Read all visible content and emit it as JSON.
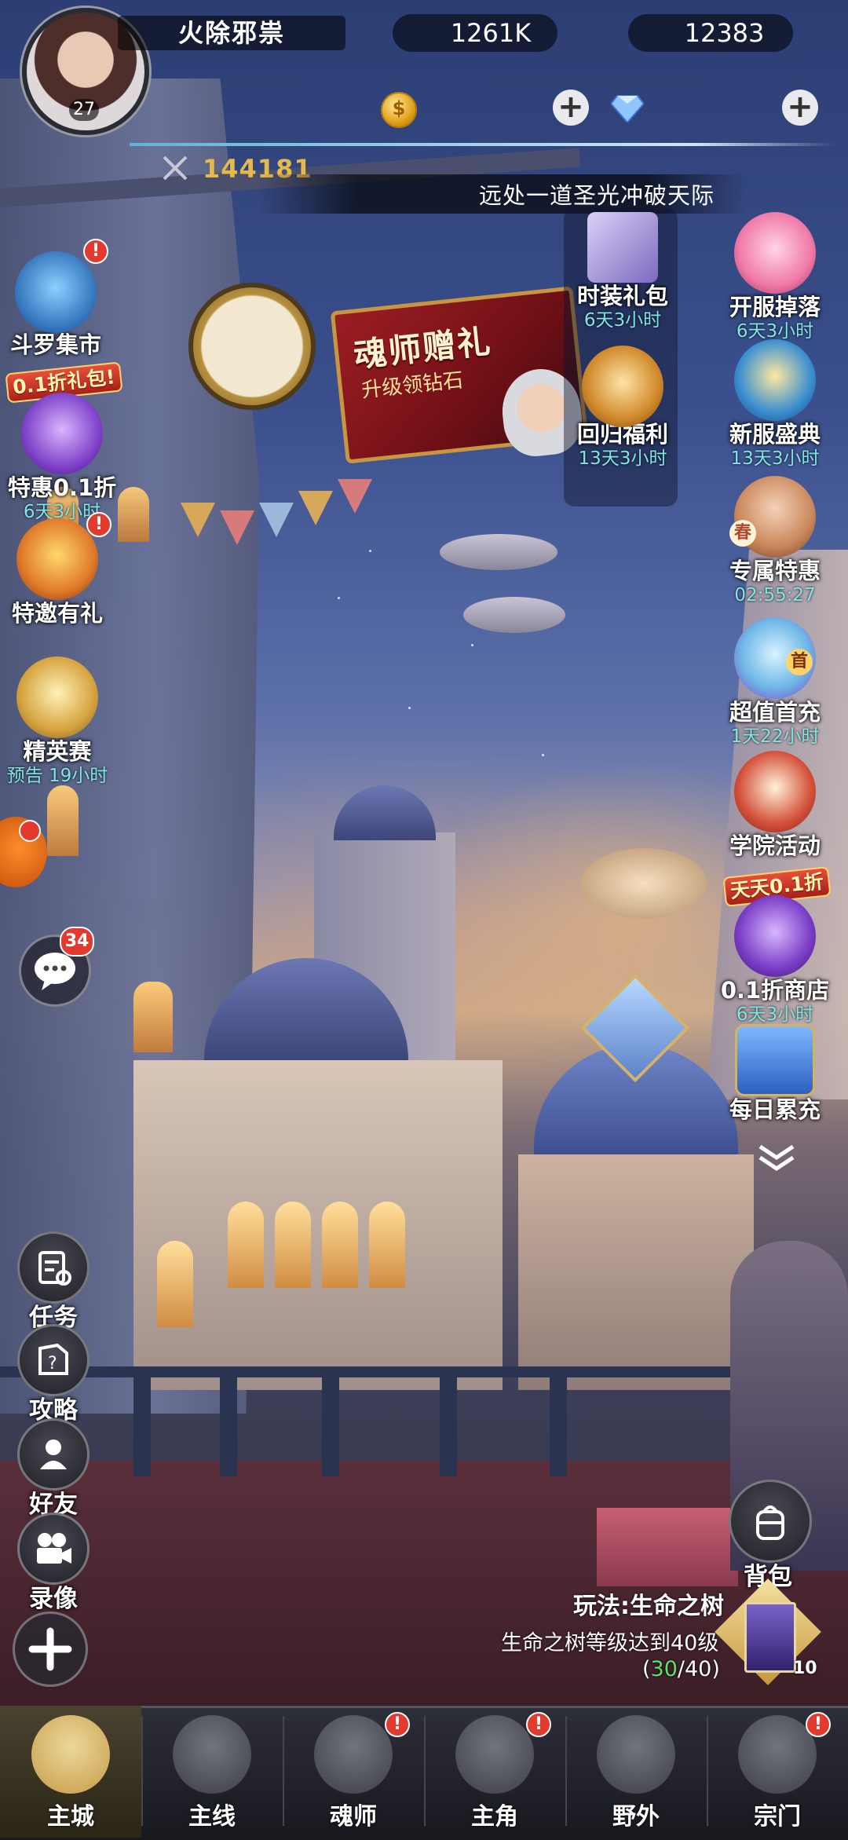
{
  "player": {
    "name": "火除邪祟",
    "level": "27",
    "power": "144181"
  },
  "resources": {
    "gold": "1261K",
    "diamonds": "12383"
  },
  "marquee": "远处一道圣光冲破天际",
  "banner": {
    "title": "魂师赠礼",
    "subtitle": "升级领钻石"
  },
  "left_events": [
    {
      "label": "斗罗集市",
      "time": ""
    },
    {
      "label": "特惠0.1折",
      "time": "6天3小时",
      "tag": "0.1折礼包!"
    },
    {
      "label": "特邀有礼",
      "time": ""
    },
    {
      "label": "精英赛",
      "time": "预告 19小时"
    }
  ],
  "chat_badge": "34",
  "right_events": [
    {
      "label": "时装礼包",
      "time": "6天3小时"
    },
    {
      "label": "回归福利",
      "time": "13天3小时"
    },
    {
      "label": "开服掉落",
      "time": "6天3小时"
    },
    {
      "label": "新服盛典",
      "time": "13天3小时"
    },
    {
      "label": "专属特惠",
      "time": "02:55:27",
      "tag": "春"
    },
    {
      "label": "超值首充",
      "time": "1天22小时",
      "tag": "首"
    },
    {
      "label": "学院活动",
      "time": ""
    },
    {
      "label": "0.1折商店",
      "time": "6天3小时",
      "tag": "天天0.1折"
    },
    {
      "label": "每日累充",
      "time": ""
    }
  ],
  "quick_buttons": [
    {
      "label": "任务"
    },
    {
      "label": "攻略"
    },
    {
      "label": "好友"
    },
    {
      "label": "录像"
    }
  ],
  "backpack": "背包",
  "task": {
    "title": "玩法:生命之树",
    "desc": "生命之树等级达到40级",
    "progress_current": "30",
    "progress_total": "/40",
    "card_count": "10"
  },
  "nav": [
    {
      "label": "主城",
      "active": true
    },
    {
      "label": "主线"
    },
    {
      "label": "魂师"
    },
    {
      "label": "主角"
    },
    {
      "label": "野外"
    },
    {
      "label": "宗门"
    }
  ],
  "colors": {
    "timer": "#7fe6e6",
    "gold_text": "#e6b94c",
    "badge_red": "#e23a2e",
    "progress_green": "#5ee06a"
  }
}
